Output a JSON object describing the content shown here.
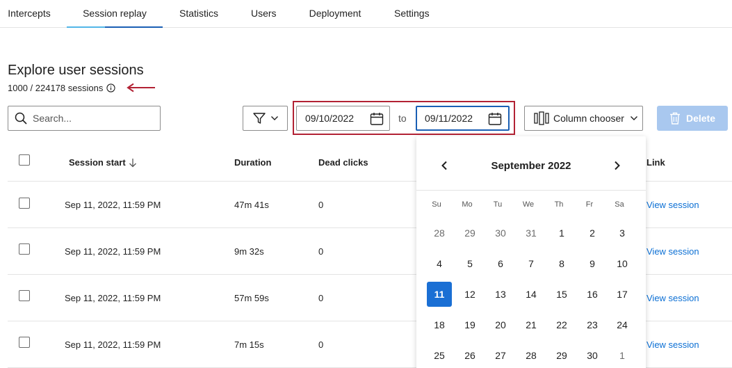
{
  "tabs": [
    {
      "label": "Intercepts"
    },
    {
      "label": "Session replay"
    },
    {
      "label": "Statistics"
    },
    {
      "label": "Users"
    },
    {
      "label": "Deployment"
    },
    {
      "label": "Settings"
    }
  ],
  "header": {
    "title": "Explore user sessions",
    "session_count": "1000 / 224178 sessions"
  },
  "toolbar": {
    "search_placeholder": "Search...",
    "date_from": "09/10/2022",
    "date_to_label": "to",
    "date_to": "09/11/2022",
    "column_chooser_label": "Column chooser",
    "delete_label": "Delete"
  },
  "table": {
    "columns": [
      "Session start",
      "Duration",
      "Dead clicks",
      "Link"
    ],
    "rows": [
      {
        "start": "Sep 11, 2022, 11:59 PM",
        "duration": "47m 41s",
        "dead_clicks": "0",
        "link": "View session"
      },
      {
        "start": "Sep 11, 2022, 11:59 PM",
        "duration": "9m 32s",
        "dead_clicks": "0",
        "link": "View session"
      },
      {
        "start": "Sep 11, 2022, 11:59 PM",
        "duration": "57m 59s",
        "dead_clicks": "0",
        "link": "View session"
      },
      {
        "start": "Sep 11, 2022, 11:59 PM",
        "duration": "7m 15s",
        "dead_clicks": "0",
        "link": "View session"
      }
    ]
  },
  "calendar": {
    "title": "September 2022",
    "weekdays": [
      "Su",
      "Mo",
      "Tu",
      "We",
      "Th",
      "Fr",
      "Sa"
    ],
    "weeks": [
      [
        "28",
        "29",
        "30",
        "31",
        "1",
        "2",
        "3"
      ],
      [
        "4",
        "5",
        "6",
        "7",
        "8",
        "9",
        "10"
      ],
      [
        "11",
        "12",
        "13",
        "14",
        "15",
        "16",
        "17"
      ],
      [
        "18",
        "19",
        "20",
        "21",
        "22",
        "23",
        "24"
      ],
      [
        "25",
        "26",
        "27",
        "28",
        "29",
        "30",
        "1"
      ]
    ],
    "selected_day": "11"
  },
  "colors": {
    "accent": "#1a6fd4",
    "highlight": "#b22234",
    "link": "#0b6fd4",
    "delete_disabled": "#a9c8ef"
  },
  "icons": {
    "search": "search-icon",
    "filter": "filter-icon",
    "calendar": "calendar-icon",
    "columns": "columns-icon",
    "trash": "trash-icon",
    "info": "info-icon",
    "sort": "arrow-down-icon"
  }
}
